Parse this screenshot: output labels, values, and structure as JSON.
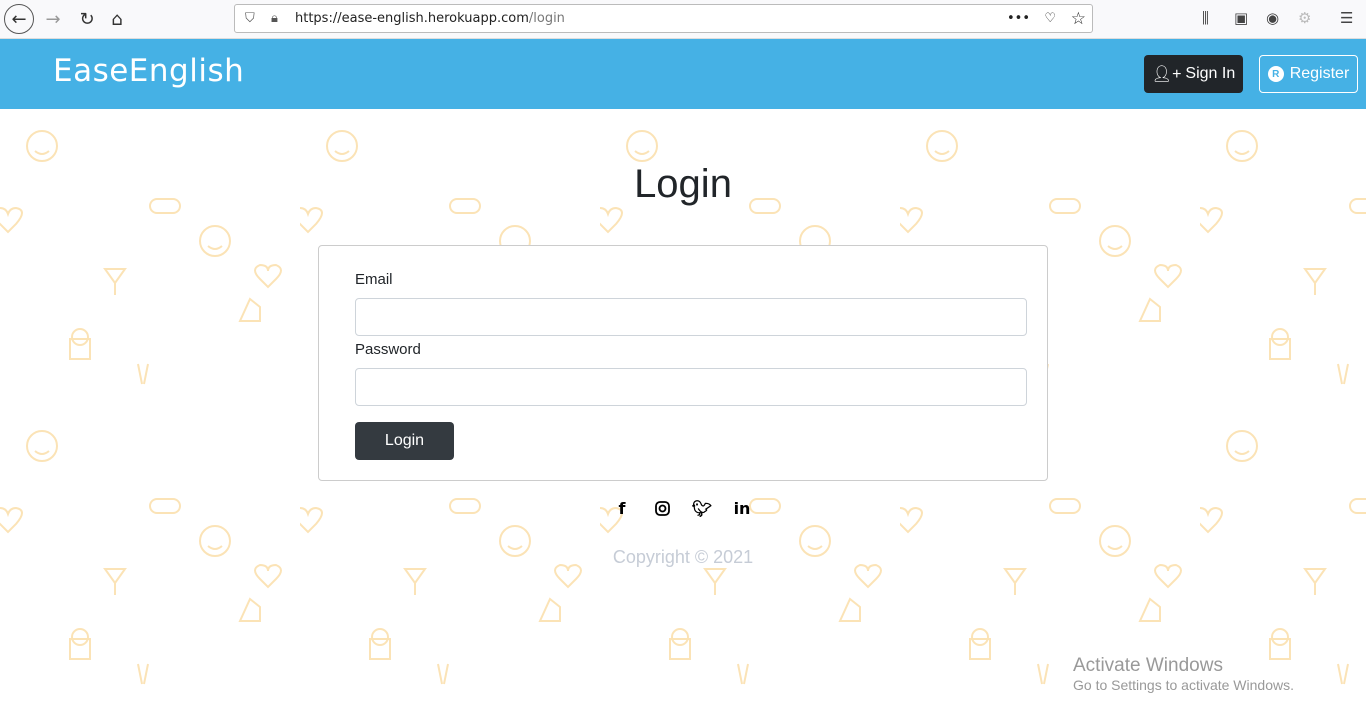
{
  "browser": {
    "url_host": "https://ease-english.herokuapp.com",
    "url_path": "/login"
  },
  "navbar": {
    "brand": "EaseEnglish",
    "signin_label": "Sign In",
    "register_label": "Register",
    "register_icon_letter": "R"
  },
  "main": {
    "title": "Login",
    "email_label": "Email",
    "email_value": "",
    "password_label": "Password",
    "password_value": "",
    "login_label": "Login"
  },
  "footer": {
    "social": [
      "facebook-icon",
      "instagram-icon",
      "twitter-icon",
      "linkedin-icon"
    ],
    "copyright": "Copyright © 2021"
  },
  "watermark": {
    "title": "Activate Windows",
    "subtitle": "Go to Settings to activate Windows."
  },
  "colors": {
    "navbar": "#45b1e5",
    "dark_button": "#212529",
    "pattern": "#fbe3b6"
  }
}
